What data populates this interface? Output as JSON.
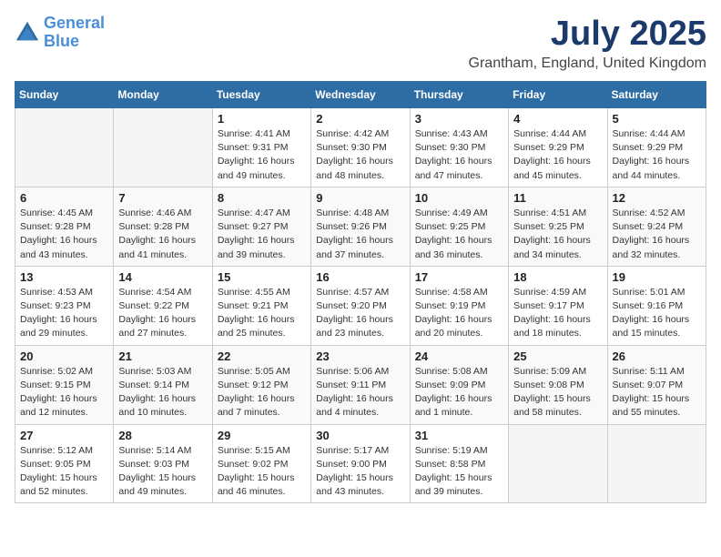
{
  "header": {
    "logo_line1": "General",
    "logo_line2": "Blue",
    "month": "July 2025",
    "location": "Grantham, England, United Kingdom"
  },
  "days_of_week": [
    "Sunday",
    "Monday",
    "Tuesday",
    "Wednesday",
    "Thursday",
    "Friday",
    "Saturday"
  ],
  "weeks": [
    [
      {
        "day": "",
        "empty": true
      },
      {
        "day": "",
        "empty": true
      },
      {
        "day": "1",
        "sunrise": "4:41 AM",
        "sunset": "9:31 PM",
        "daylight": "16 hours and 49 minutes."
      },
      {
        "day": "2",
        "sunrise": "4:42 AM",
        "sunset": "9:30 PM",
        "daylight": "16 hours and 48 minutes."
      },
      {
        "day": "3",
        "sunrise": "4:43 AM",
        "sunset": "9:30 PM",
        "daylight": "16 hours and 47 minutes."
      },
      {
        "day": "4",
        "sunrise": "4:44 AM",
        "sunset": "9:29 PM",
        "daylight": "16 hours and 45 minutes."
      },
      {
        "day": "5",
        "sunrise": "4:44 AM",
        "sunset": "9:29 PM",
        "daylight": "16 hours and 44 minutes."
      }
    ],
    [
      {
        "day": "6",
        "sunrise": "4:45 AM",
        "sunset": "9:28 PM",
        "daylight": "16 hours and 43 minutes."
      },
      {
        "day": "7",
        "sunrise": "4:46 AM",
        "sunset": "9:28 PM",
        "daylight": "16 hours and 41 minutes."
      },
      {
        "day": "8",
        "sunrise": "4:47 AM",
        "sunset": "9:27 PM",
        "daylight": "16 hours and 39 minutes."
      },
      {
        "day": "9",
        "sunrise": "4:48 AM",
        "sunset": "9:26 PM",
        "daylight": "16 hours and 37 minutes."
      },
      {
        "day": "10",
        "sunrise": "4:49 AM",
        "sunset": "9:25 PM",
        "daylight": "16 hours and 36 minutes."
      },
      {
        "day": "11",
        "sunrise": "4:51 AM",
        "sunset": "9:25 PM",
        "daylight": "16 hours and 34 minutes."
      },
      {
        "day": "12",
        "sunrise": "4:52 AM",
        "sunset": "9:24 PM",
        "daylight": "16 hours and 32 minutes."
      }
    ],
    [
      {
        "day": "13",
        "sunrise": "4:53 AM",
        "sunset": "9:23 PM",
        "daylight": "16 hours and 29 minutes."
      },
      {
        "day": "14",
        "sunrise": "4:54 AM",
        "sunset": "9:22 PM",
        "daylight": "16 hours and 27 minutes."
      },
      {
        "day": "15",
        "sunrise": "4:55 AM",
        "sunset": "9:21 PM",
        "daylight": "16 hours and 25 minutes."
      },
      {
        "day": "16",
        "sunrise": "4:57 AM",
        "sunset": "9:20 PM",
        "daylight": "16 hours and 23 minutes."
      },
      {
        "day": "17",
        "sunrise": "4:58 AM",
        "sunset": "9:19 PM",
        "daylight": "16 hours and 20 minutes."
      },
      {
        "day": "18",
        "sunrise": "4:59 AM",
        "sunset": "9:17 PM",
        "daylight": "16 hours and 18 minutes."
      },
      {
        "day": "19",
        "sunrise": "5:01 AM",
        "sunset": "9:16 PM",
        "daylight": "16 hours and 15 minutes."
      }
    ],
    [
      {
        "day": "20",
        "sunrise": "5:02 AM",
        "sunset": "9:15 PM",
        "daylight": "16 hours and 12 minutes."
      },
      {
        "day": "21",
        "sunrise": "5:03 AM",
        "sunset": "9:14 PM",
        "daylight": "16 hours and 10 minutes."
      },
      {
        "day": "22",
        "sunrise": "5:05 AM",
        "sunset": "9:12 PM",
        "daylight": "16 hours and 7 minutes."
      },
      {
        "day": "23",
        "sunrise": "5:06 AM",
        "sunset": "9:11 PM",
        "daylight": "16 hours and 4 minutes."
      },
      {
        "day": "24",
        "sunrise": "5:08 AM",
        "sunset": "9:09 PM",
        "daylight": "16 hours and 1 minute."
      },
      {
        "day": "25",
        "sunrise": "5:09 AM",
        "sunset": "9:08 PM",
        "daylight": "15 hours and 58 minutes."
      },
      {
        "day": "26",
        "sunrise": "5:11 AM",
        "sunset": "9:07 PM",
        "daylight": "15 hours and 55 minutes."
      }
    ],
    [
      {
        "day": "27",
        "sunrise": "5:12 AM",
        "sunset": "9:05 PM",
        "daylight": "15 hours and 52 minutes."
      },
      {
        "day": "28",
        "sunrise": "5:14 AM",
        "sunset": "9:03 PM",
        "daylight": "15 hours and 49 minutes."
      },
      {
        "day": "29",
        "sunrise": "5:15 AM",
        "sunset": "9:02 PM",
        "daylight": "15 hours and 46 minutes."
      },
      {
        "day": "30",
        "sunrise": "5:17 AM",
        "sunset": "9:00 PM",
        "daylight": "15 hours and 43 minutes."
      },
      {
        "day": "31",
        "sunrise": "5:19 AM",
        "sunset": "8:58 PM",
        "daylight": "15 hours and 39 minutes."
      },
      {
        "day": "",
        "empty": true
      },
      {
        "day": "",
        "empty": true
      }
    ]
  ]
}
